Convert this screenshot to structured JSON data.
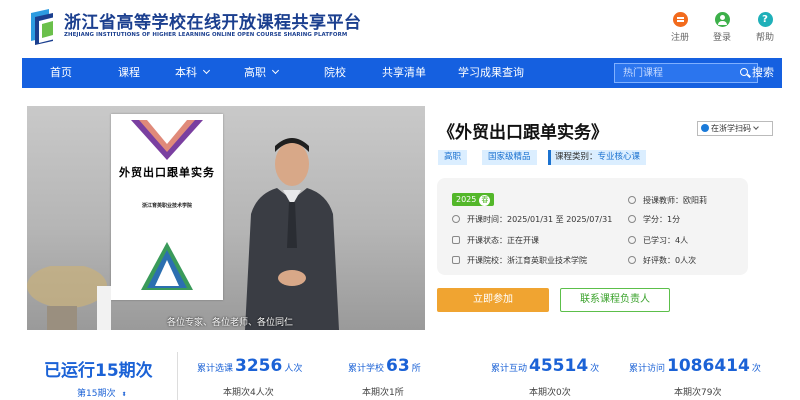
{
  "header": {
    "site_title": "浙江省高等学校在线开放课程共享平台",
    "site_subtitle": "ZHEJIANG INSTITUTIONS OF HIGHER LEARNING ONLINE OPEN COURSE SHARING PLATFORM",
    "links": [
      {
        "label": "注册",
        "icon": "register-icon",
        "color": "#f26b1d"
      },
      {
        "label": "登录",
        "icon": "login-icon",
        "color": "#3db04a"
      },
      {
        "label": "帮助",
        "icon": "help-icon",
        "glyph": "?",
        "color": "#1fb0b9"
      }
    ]
  },
  "nav": {
    "items": [
      "首页",
      "课程",
      "本科",
      "高职",
      "院校",
      "共享清单",
      "学习成果查询"
    ],
    "search_placeholder": "热门课程",
    "search_label": "搜索"
  },
  "video": {
    "poster_title": "外贸出口跟单实务",
    "poster_subtitle": "浙江育英职业技术学院",
    "caption": "各位专家、各位老师、各位同仁"
  },
  "course": {
    "title": "《外贸出口跟单实务》",
    "qr_label": "在浙学扫码",
    "tags": {
      "level": "高职",
      "grade": "国家级精品",
      "category_label": "课程类别：",
      "category_value": "专业核心课"
    },
    "year": "2025",
    "season": "春",
    "info": {
      "open_time": "开课时间：2025/01/31 至 2025/07/31",
      "status": "开课状态：正在开课",
      "school": "开课院校：浙江育英职业技术学院",
      "teacher": "授课教师：欧阳莉",
      "credit": "学分：1分",
      "learned": "已学习：4人",
      "rating": "好评数：0人次"
    },
    "join_label": "立即参加",
    "contact_label": "联系课程负责人"
  },
  "stats": {
    "run_periods": "已运行15期次",
    "current_period": "第15期次",
    "period_toggle": "⬍",
    "items": [
      {
        "label": "累计选课",
        "value": "3256",
        "unit": "人次",
        "sub": "本期次4人次"
      },
      {
        "label": "累计学校",
        "value": "63",
        "unit": "所",
        "sub": "本期次1所"
      },
      {
        "label": "累计互动",
        "value": "45514",
        "unit": "次",
        "sub": "本期次0次"
      },
      {
        "label": "累计访问",
        "value": "1086414",
        "unit": "次",
        "sub": "本期次79次"
      }
    ]
  }
}
